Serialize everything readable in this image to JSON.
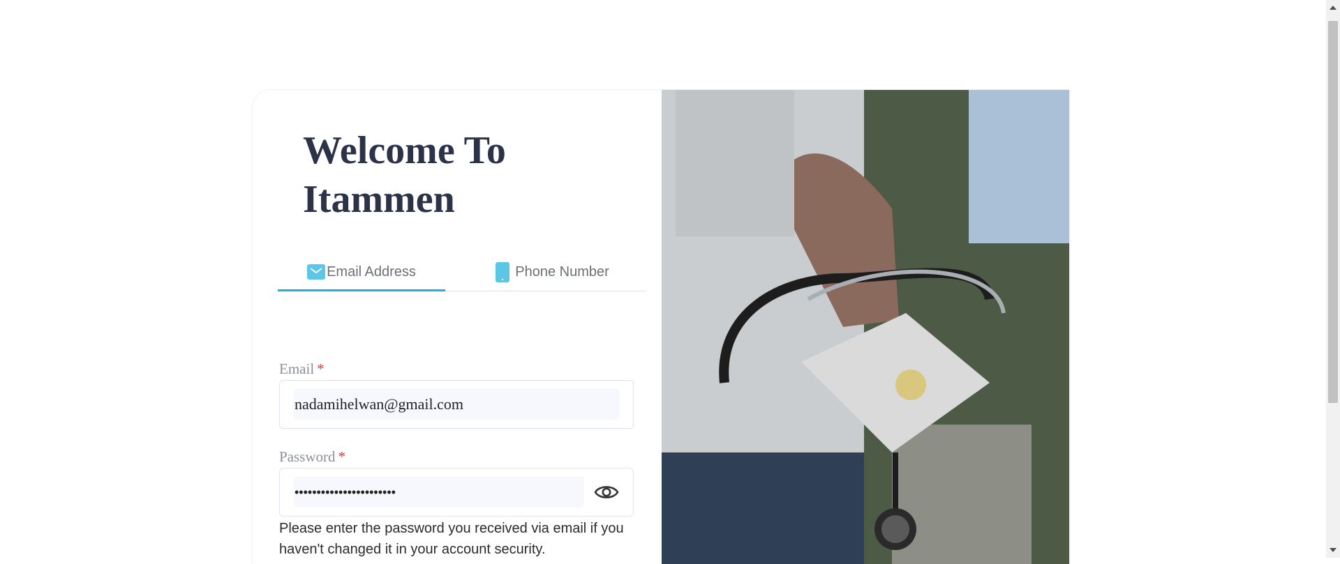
{
  "welcome": {
    "title": "Welcome To Itammen"
  },
  "tabs": [
    {
      "label": "Email Address",
      "icon": "mail-icon",
      "active": true
    },
    {
      "label": "Phone Number",
      "icon": "phone-icon",
      "active": false
    }
  ],
  "form": {
    "email_label": "Email",
    "email_required": "*",
    "email_value": "nadamihelwan@gmail.com",
    "password_label": "Password",
    "password_required": "*",
    "password_value": "•••••••••••••••••••••••",
    "password_hint": "Please enter the password you received via email if you haven't changed it in your account security."
  },
  "colors": {
    "accent": "#1fb2d8",
    "title": "#2c3349",
    "required": "#e53935",
    "icon": "#5bc6e6"
  }
}
